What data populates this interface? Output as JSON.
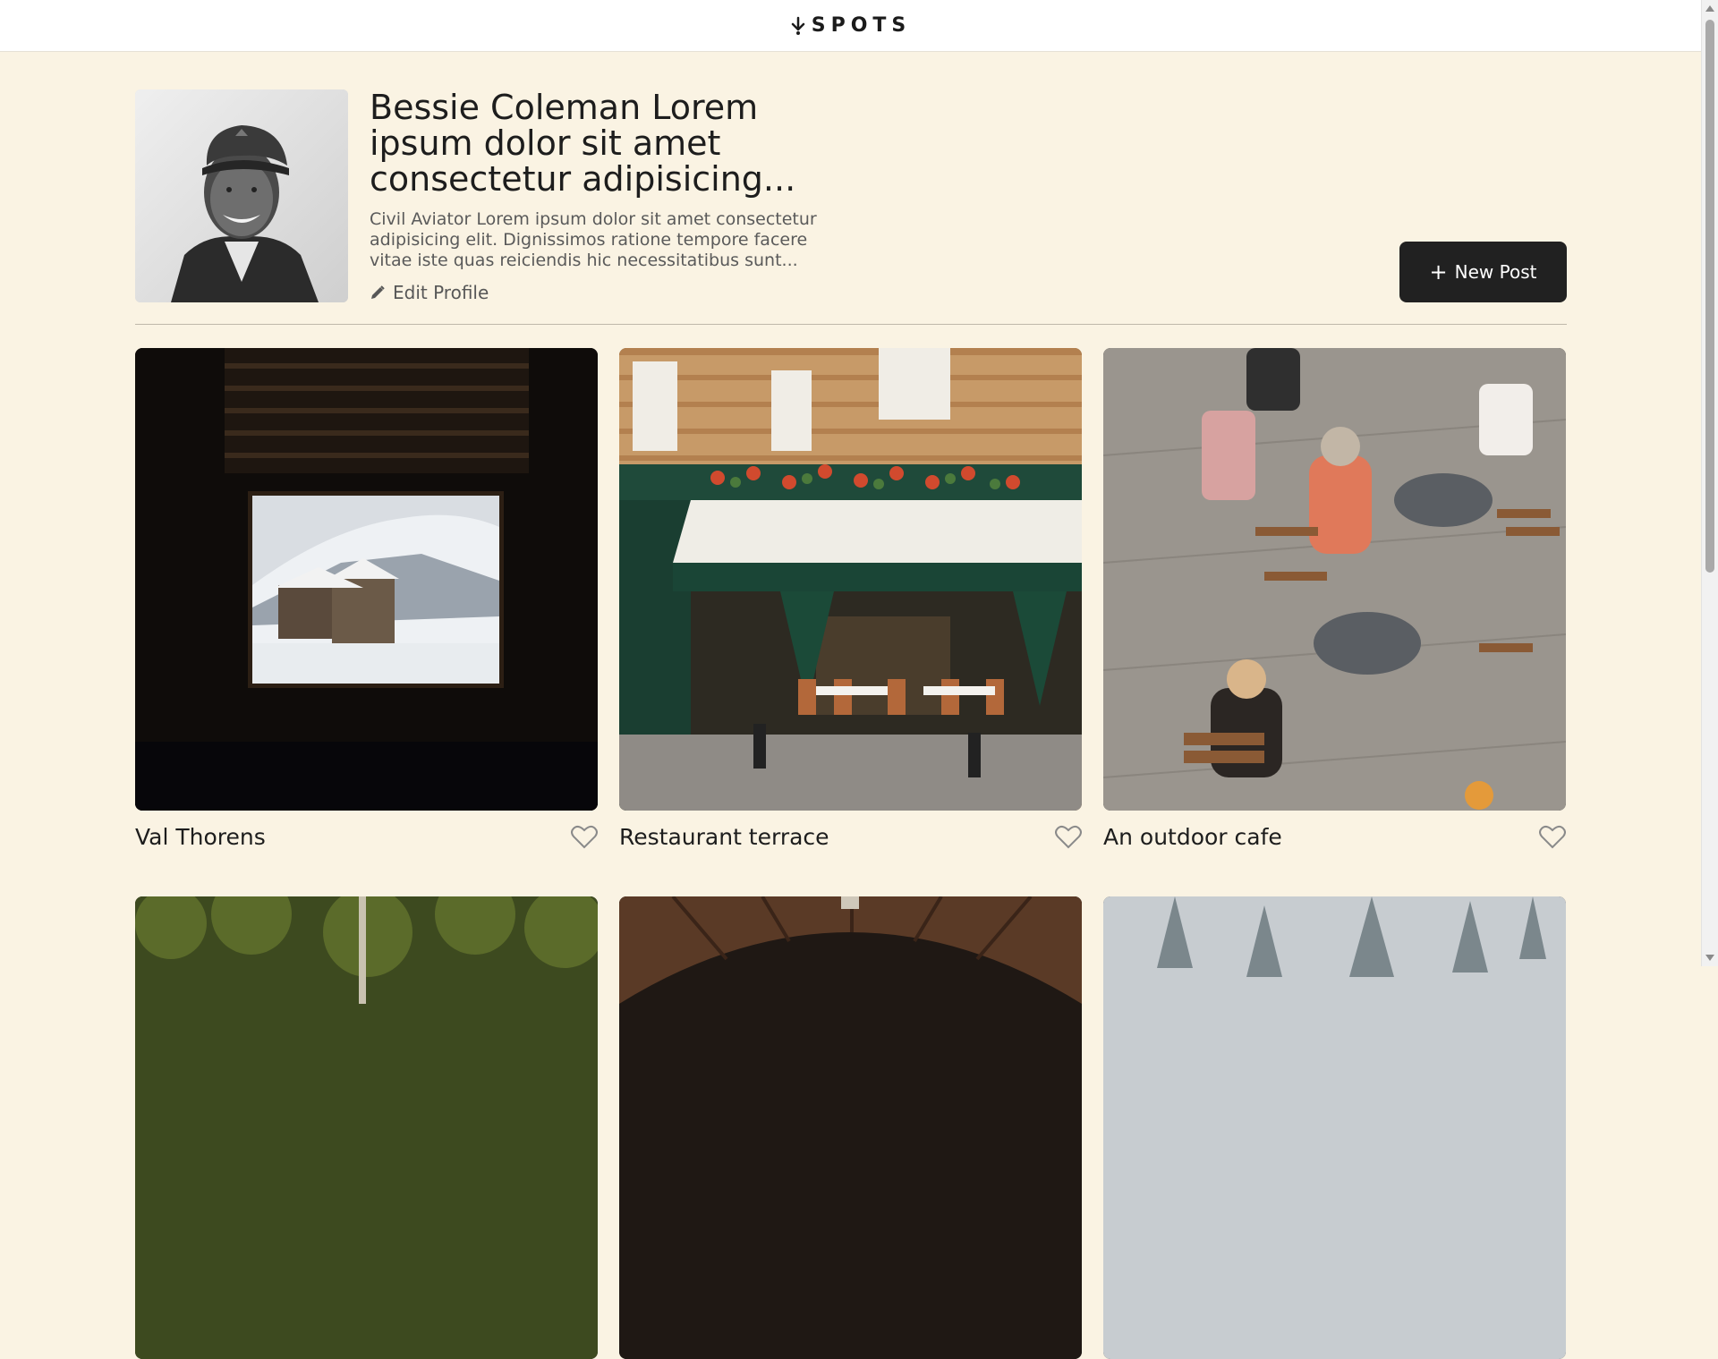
{
  "header": {
    "logo_text": "SPOTS",
    "logo_icon": "spots-logo-icon"
  },
  "profile": {
    "name": "Bessie Coleman Lorem ipsum dolor sit amet consectetur adipisicing...",
    "bio": "Civil Aviator Lorem ipsum dolor sit amet consectetur adipisicing elit. Dignissimos ratione tempore facere vitae iste quas reiciendis hic necessitatibus sunt...",
    "edit_label": "Edit Profile",
    "edit_icon": "pencil-icon",
    "avatar_icon": "avatar-photo"
  },
  "actions": {
    "new_post_icon": "plus-icon",
    "new_post_label": "New Post"
  },
  "cards": [
    {
      "title": "Val Thorens",
      "liked": false,
      "image": "window-snow-view"
    },
    {
      "title": "Restaurant terrace",
      "liked": false,
      "image": "restaurant-facade"
    },
    {
      "title": "An outdoor cafe",
      "liked": false,
      "image": "cafe-tables"
    },
    {
      "title": "",
      "liked": false,
      "image": "forest"
    },
    {
      "title": "",
      "liked": false,
      "image": "wooden-arch"
    },
    {
      "title": "",
      "liked": false,
      "image": "snowy-trees"
    }
  ],
  "colors": {
    "page_background": "#FAF3E3",
    "header_background": "#FFFFFF",
    "button_background": "#212121",
    "button_text": "#FFFFFF",
    "text_primary": "#212121",
    "text_secondary": "#5A5A5A"
  }
}
